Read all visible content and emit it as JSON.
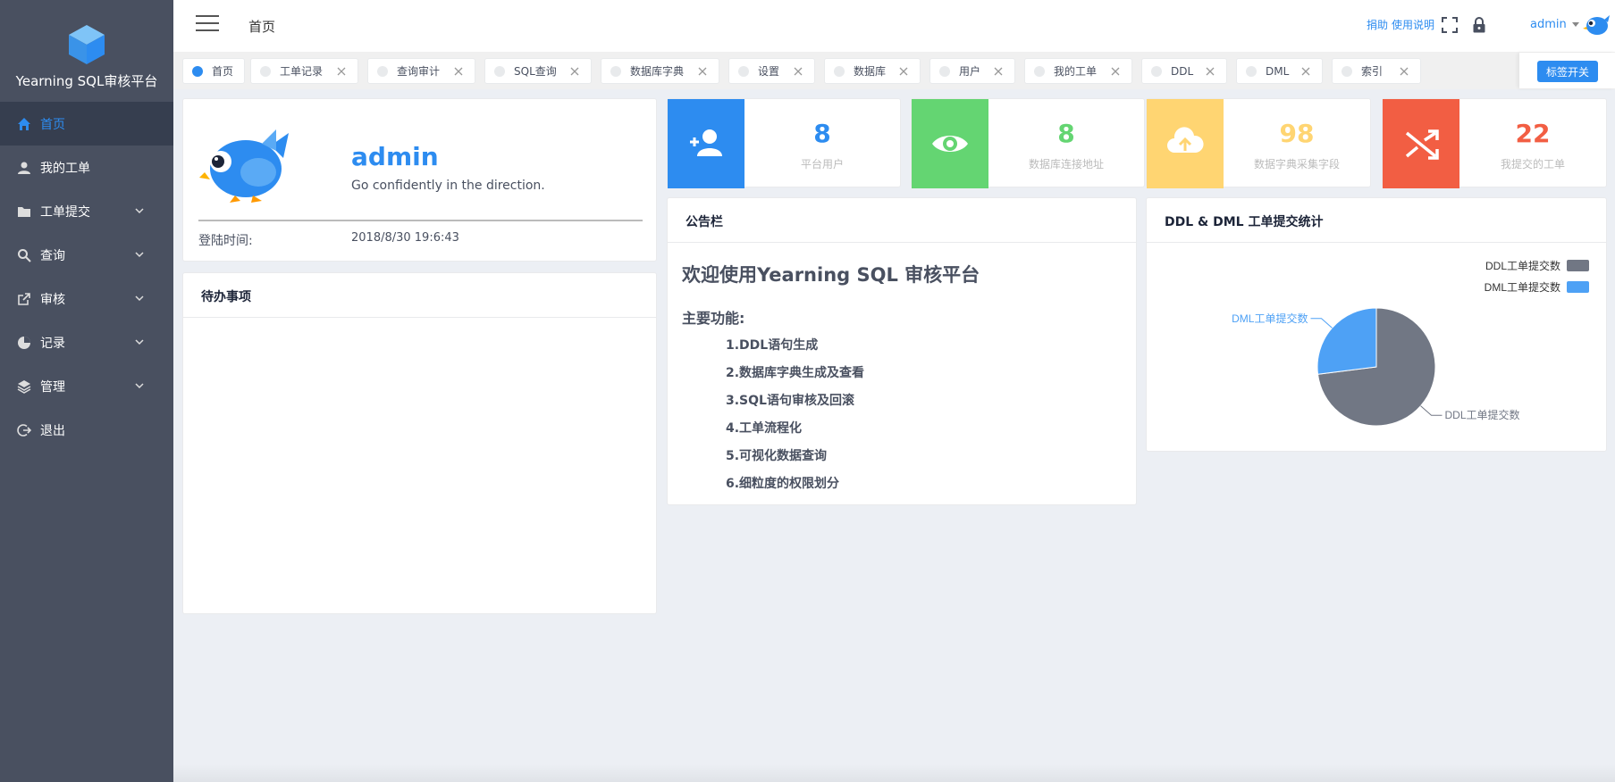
{
  "app": {
    "name": "Yearning SQL审核平台"
  },
  "sidebar": {
    "items": [
      {
        "label": "首页",
        "icon": "home-icon",
        "active": true,
        "expandable": false
      },
      {
        "label": "我的工单",
        "icon": "person-icon",
        "active": false,
        "expandable": false
      },
      {
        "label": "工单提交",
        "icon": "folder-icon",
        "active": false,
        "expandable": true
      },
      {
        "label": "查询",
        "icon": "search-icon",
        "active": false,
        "expandable": true
      },
      {
        "label": "审核",
        "icon": "external-link-icon",
        "active": false,
        "expandable": true
      },
      {
        "label": "记录",
        "icon": "pie-chart-icon",
        "active": false,
        "expandable": true
      },
      {
        "label": "管理",
        "icon": "layers-icon",
        "active": false,
        "expandable": true
      },
      {
        "label": "退出",
        "icon": "logout-icon",
        "active": false,
        "expandable": false
      }
    ]
  },
  "header": {
    "title": "首页",
    "donate": "捐助",
    "manual": "使用说明",
    "user": "admin"
  },
  "tags": {
    "items": [
      {
        "label": "首页",
        "active": true,
        "closable": false
      },
      {
        "label": "工单记录",
        "active": false,
        "closable": true
      },
      {
        "label": "查询审计",
        "active": false,
        "closable": true
      },
      {
        "label": "SQL查询",
        "active": false,
        "closable": true
      },
      {
        "label": "数据库字典",
        "active": false,
        "closable": true
      },
      {
        "label": "设置",
        "active": false,
        "closable": true
      },
      {
        "label": "数据库",
        "active": false,
        "closable": true
      },
      {
        "label": "用户",
        "active": false,
        "closable": true
      },
      {
        "label": "我的工单",
        "active": false,
        "closable": true
      },
      {
        "label": "DDL",
        "active": false,
        "closable": true
      },
      {
        "label": "DML",
        "active": false,
        "closable": true
      },
      {
        "label": "索引",
        "active": false,
        "closable": true
      }
    ],
    "toggle": "标签开关"
  },
  "profile": {
    "name": "admin",
    "motto": "Go confidently in the direction.",
    "login_label": "登陆时间:",
    "login_time": "2018/8/30 19:6:43"
  },
  "todo": {
    "title": "待办事项"
  },
  "stats": [
    {
      "value": "8",
      "label": "平台用户",
      "color": "#2d8cf0",
      "icon": "add-user-icon"
    },
    {
      "value": "8",
      "label": "数据库连接地址",
      "color": "#64d572",
      "icon": "eye-icon"
    },
    {
      "value": "98",
      "label": "数据字典采集字段",
      "color": "#ffd572",
      "icon": "cloud-upload-icon"
    },
    {
      "value": "22",
      "label": "我提交的工单",
      "color": "#f25e43",
      "icon": "shuffle-icon"
    }
  ],
  "notice": {
    "head": "公告栏",
    "title": "欢迎使用Yearning SQL 审核平台",
    "subtitle": "主要功能:",
    "features": [
      "1.DDL语句生成",
      "2.数据库字典生成及查看",
      "3.SQL语句审核及回滚",
      "4.工单流程化",
      "5.可视化数据查询",
      "6.细粒度的权限划分"
    ]
  },
  "chart_data": {
    "type": "pie",
    "title": "DDL & DML 工单提交统计",
    "legend_position": "top-right",
    "series": [
      {
        "name": "DDL工单提交数",
        "value": 73,
        "color": "#717784"
      },
      {
        "name": "DML工单提交数",
        "value": 27,
        "color": "#4ea1f5"
      }
    ]
  },
  "colors": {
    "accent": "#2d8cf0",
    "sidebar": "#495060",
    "sidebar_active": "#363e4f"
  }
}
